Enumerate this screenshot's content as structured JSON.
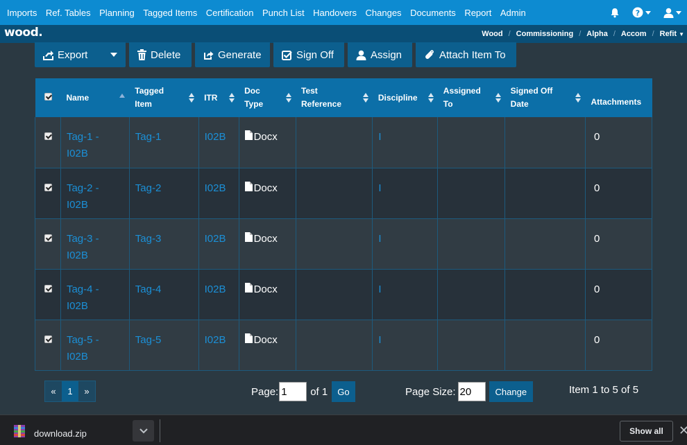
{
  "nav": {
    "items": [
      "Imports",
      "Ref. Tables",
      "Planning",
      "Tagged Items",
      "Certification",
      "Punch List",
      "Handovers",
      "Changes",
      "Documents",
      "Report",
      "Admin"
    ]
  },
  "brand": {
    "logo": "wood."
  },
  "breadcrumbs": [
    "Wood",
    "Commissioning",
    "Alpha",
    "Accom",
    "Refit"
  ],
  "toolbar": {
    "export": "Export",
    "delete": "Delete",
    "generate": "Generate",
    "signoff": "Sign Off",
    "assign": "Assign",
    "attach": "Attach Item To"
  },
  "table": {
    "headers": {
      "name": "Name",
      "tagged_item": [
        "Tagged",
        "Item"
      ],
      "itr": "ITR",
      "doc_type": [
        "Doc",
        "Type"
      ],
      "test_reference": [
        "Test",
        "Reference"
      ],
      "discipline": "Discipline",
      "assigned_to": [
        "Assigned",
        "To"
      ],
      "signed_off_date": [
        "Signed Off",
        "Date"
      ],
      "attachments": "Attachments"
    },
    "rows": [
      {
        "name": [
          "Tag-1 -",
          "I02B"
        ],
        "tagged_item": "Tag-1",
        "itr": "I02B",
        "doc_type": "Docx",
        "test_reference": "",
        "discipline": "I",
        "assigned_to": "",
        "signed_off_date": "",
        "attachments": "0"
      },
      {
        "name": [
          "Tag-2 -",
          "I02B"
        ],
        "tagged_item": "Tag-2",
        "itr": "I02B",
        "doc_type": "Docx",
        "test_reference": "",
        "discipline": "I",
        "assigned_to": "",
        "signed_off_date": "",
        "attachments": "0"
      },
      {
        "name": [
          "Tag-3 -",
          "I02B"
        ],
        "tagged_item": "Tag-3",
        "itr": "I02B",
        "doc_type": "Docx",
        "test_reference": "",
        "discipline": "I",
        "assigned_to": "",
        "signed_off_date": "",
        "attachments": "0"
      },
      {
        "name": [
          "Tag-4 -",
          "I02B"
        ],
        "tagged_item": "Tag-4",
        "itr": "I02B",
        "doc_type": "Docx",
        "test_reference": "",
        "discipline": "I",
        "assigned_to": "",
        "signed_off_date": "",
        "attachments": "0"
      },
      {
        "name": [
          "Tag-5 -",
          "I02B"
        ],
        "tagged_item": "Tag-5",
        "itr": "I02B",
        "doc_type": "Docx",
        "test_reference": "",
        "discipline": "I",
        "assigned_to": "",
        "signed_off_date": "",
        "attachments": "0"
      }
    ]
  },
  "pager": {
    "first": "«",
    "current": "1",
    "last": "»",
    "page_label": "Page:",
    "page_value": "1",
    "of_label": "of 1",
    "go": "Go",
    "size_label": "Page Size:",
    "size_value": "20",
    "change": "Change",
    "item_count": "Item 1 to 5 of 5"
  },
  "download_bar": {
    "file": "download.zip",
    "show_all": "Show all",
    "close": "✕"
  },
  "colors": {
    "nav": "#0d8bd1",
    "brandbar": "#0a4e76",
    "button": "#0c5f8e",
    "link": "#1b8fd6",
    "page": "#2b3942"
  }
}
